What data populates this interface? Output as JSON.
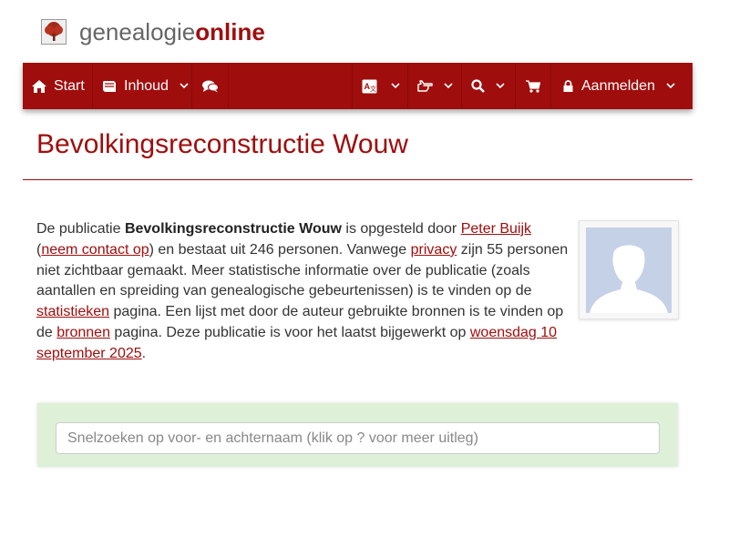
{
  "brand": {
    "part1": "genealogie",
    "part2": "online"
  },
  "nav": {
    "start": "Start",
    "inhoud": "Inhoud",
    "aanmelden": "Aanmelden"
  },
  "page": {
    "title": "Bevolkingsreconstructie Wouw"
  },
  "intro": {
    "t1": "De publicatie ",
    "pub_name": "Bevolkingsreconstructie Wouw",
    "t2": " is opgesteld door ",
    "author": "Peter Buijk",
    "t3": "(",
    "contact": "neem contact op",
    "t4": ") en bestaat uit 246 personen. Vanwege ",
    "privacy": "privacy",
    "t5": " zijn 55 personen niet zichtbaar gemaakt. Meer statistische informatie over de publicatie (zoals aantallen en spreiding van genealogische gebeurtenissen) is te vinden op de ",
    "statistieken": "statistieken",
    "t6": " pagina. Een lijst met door de auteur gebruikte bronnen is te vinden op de ",
    "bronnen": "bronnen",
    "t7": " pagina. Deze publicatie is voor het laatst bijgewerkt op ",
    "date": "woensdag 10 september 2025",
    "t8": "."
  },
  "search": {
    "placeholder": "Snelzoeken op voor- en achternaam (klik op ? voor meer uitleg)"
  },
  "colors": {
    "brand": "#a00d0d",
    "search_panel": "#dff0d8"
  }
}
